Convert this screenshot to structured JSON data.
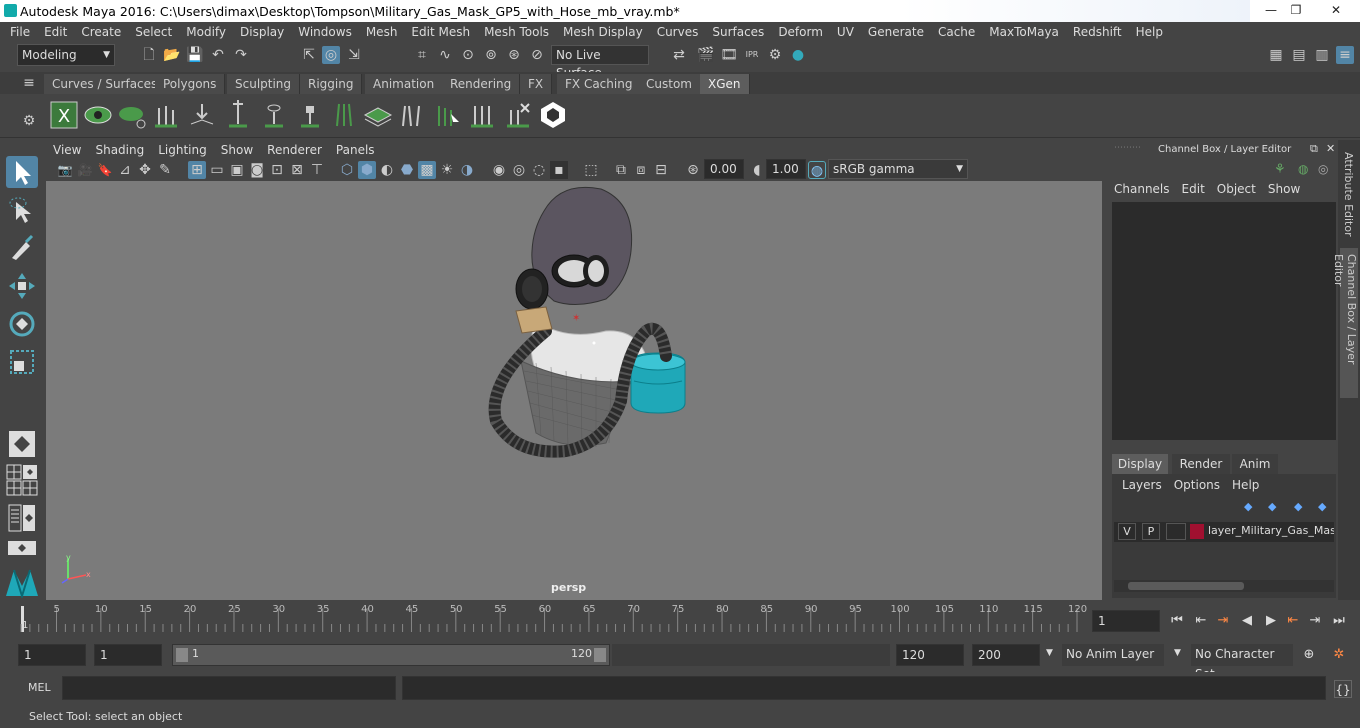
{
  "window": {
    "title": "Autodesk Maya 2016: C:\\Users\\dimax\\Desktop\\Tompson\\Military_Gas_Mask_GP5_with_Hose_mb_vray.mb*",
    "controls": [
      "—",
      "❐",
      "✕"
    ]
  },
  "menubar": [
    "File",
    "Edit",
    "Create",
    "Select",
    "Modify",
    "Display",
    "Windows",
    "Mesh",
    "Edit Mesh",
    "Mesh Tools",
    "Mesh Display",
    "Curves",
    "Surfaces",
    "Deform",
    "UV",
    "Generate",
    "Cache",
    "MaxToMaya",
    "Redshift",
    "Help"
  ],
  "toolbar": {
    "mode": "Modeling",
    "live_surface": "No Live Surface"
  },
  "shelf_tabs": [
    "Curves / Surfaces",
    "Polygons",
    "Sculpting",
    "Rigging",
    "Animation",
    "Rendering",
    "FX",
    "FX Caching",
    "Custom",
    "XGen"
  ],
  "shelf_active": "XGen",
  "viewport": {
    "menu": [
      "View",
      "Shading",
      "Lighting",
      "Show",
      "Renderer",
      "Panels"
    ],
    "exposure": "0.00",
    "gamma": "1.00",
    "colorspace": "sRGB gamma",
    "camera": "persp"
  },
  "channel_box": {
    "title": "Channel Box / Layer Editor",
    "menu": [
      "Channels",
      "Edit",
      "Object",
      "Show"
    ],
    "layer_tabs": [
      "Display",
      "Render",
      "Anim"
    ],
    "layer_tab_active": "Display",
    "layer_menu": [
      "Layers",
      "Options",
      "Help"
    ],
    "layer": {
      "v": "V",
      "p": "P",
      "name": "layer_Military_Gas_Mask",
      "color": "#a01030"
    }
  },
  "side_tabs": [
    "Attribute Editor",
    "Channel Box / Layer Editor"
  ],
  "timeline": {
    "ticks": [
      "5",
      "10",
      "15",
      "20",
      "25",
      "30",
      "35",
      "40",
      "45",
      "50",
      "55",
      "60",
      "65",
      "70",
      "75",
      "80",
      "85",
      "90",
      "95",
      "100",
      "105",
      "110",
      "115",
      "120"
    ],
    "start_label": "1",
    "current_frame": "1"
  },
  "range": {
    "start": "1",
    "current": "1",
    "slider_start": "1",
    "slider_end": "120",
    "end": "120",
    "max": "200",
    "anim_layer": "No Anim Layer",
    "char_set": "No Character Set"
  },
  "command": {
    "label": "MEL"
  },
  "help_line": "Select Tool: select an object",
  "colors": {
    "accent_blue": "#5285a6",
    "canister": "#1fa8b8",
    "viewport_bg": "#7b7b7b"
  }
}
